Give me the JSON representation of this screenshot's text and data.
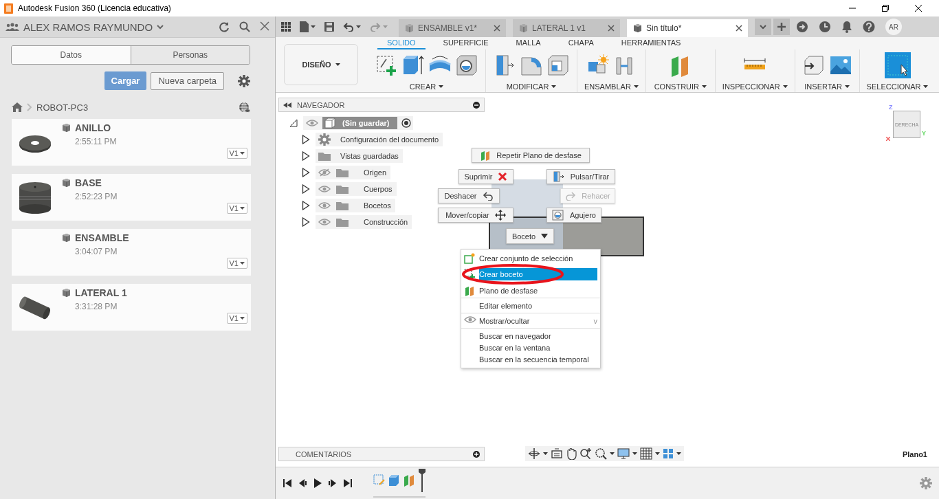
{
  "window": {
    "title": "Autodesk Fusion 360 (Licencia educativa)"
  },
  "data_panel": {
    "user": "ALEX RAMOS RAYMUNDO",
    "tabs": [
      {
        "label": "Datos",
        "selected": true
      },
      {
        "label": "Personas",
        "selected": false
      }
    ],
    "upload_button": "Cargar",
    "new_folder_button": "Nueva carpeta",
    "breadcrumb": "ROBOT-PC3",
    "files": [
      {
        "name": "ANILLO",
        "time": "2:55:11 PM",
        "version": "V1",
        "kind": "ring"
      },
      {
        "name": "BASE",
        "time": "2:52:23 PM",
        "version": "V1",
        "kind": "base"
      },
      {
        "name": "ENSAMBLE",
        "time": "3:04:07 PM",
        "version": "V1",
        "kind": "assembly"
      },
      {
        "name": "LATERAL 1",
        "time": "3:31:28 PM",
        "version": "V1",
        "kind": "cylinder"
      }
    ]
  },
  "document_tabs": [
    {
      "label": "ENSAMBLE v1*",
      "selected": false
    },
    {
      "label": "LATERAL 1 v1",
      "selected": false
    },
    {
      "label": "Sin título*",
      "selected": true
    }
  ],
  "user_initials": "AR",
  "ribbon": {
    "workspace": "DISEÑO",
    "tabs": [
      {
        "label": "SOLIDO",
        "selected": true
      },
      {
        "label": "SUPERFICIE",
        "selected": false
      },
      {
        "label": "MALLA",
        "selected": false
      },
      {
        "label": "CHAPA",
        "selected": false
      },
      {
        "label": "HERRAMIENTAS",
        "selected": false
      }
    ],
    "groups": [
      {
        "label": "CREAR",
        "tools": [
          {
            "kind": "sketch"
          },
          {
            "kind": "extrude"
          },
          {
            "kind": "revolve"
          },
          {
            "kind": "hole"
          }
        ]
      },
      {
        "label": "MODIFICAR",
        "tools": [
          {
            "kind": "pushpull"
          },
          {
            "kind": "fillet"
          },
          {
            "kind": "shell"
          }
        ]
      },
      {
        "label": "ENSAMBLAR",
        "tools": [
          {
            "kind": "component"
          },
          {
            "kind": "joint"
          }
        ]
      },
      {
        "label": "CONSTRUIR",
        "tools": [
          {
            "kind": "plane"
          }
        ]
      },
      {
        "label": "INSPECCIONAR",
        "tools": [
          {
            "kind": "measure"
          }
        ]
      },
      {
        "label": "INSERTAR",
        "tools": [
          {
            "kind": "insert"
          },
          {
            "kind": "image"
          }
        ]
      },
      {
        "label": "SELECCIONAR",
        "tools": [
          {
            "kind": "select"
          }
        ]
      }
    ]
  },
  "navigator": {
    "title": "NAVEGADOR",
    "root": {
      "label": "(Sin guardar)",
      "expanded": true
    },
    "items": [
      {
        "label": "Configuración del documento",
        "kind": "settings"
      },
      {
        "label": "Vistas guardadas",
        "kind": "views"
      },
      {
        "label": "Origen",
        "kind": "folder",
        "visible": false
      },
      {
        "label": "Cuerpos",
        "kind": "folder",
        "visible": true
      },
      {
        "label": "Bocetos",
        "kind": "folder",
        "visible": true
      },
      {
        "label": "Construcción",
        "kind": "folder",
        "visible": true
      }
    ]
  },
  "marking_menu": {
    "buttons": [
      {
        "label": "Repetir Plano de desfase",
        "kind": "plane",
        "disabled": false
      },
      {
        "label": "Suprimir",
        "kind": "delete",
        "disabled": false
      },
      {
        "label": "Pulsar/Tirar",
        "kind": "pushpull",
        "disabled": false
      },
      {
        "label": "Deshacer",
        "kind": "undo",
        "disabled": false
      },
      {
        "label": "Rehacer",
        "kind": "redo",
        "disabled": true
      },
      {
        "label": "Mover/copiar",
        "kind": "move",
        "disabled": false
      },
      {
        "label": "Agujero",
        "kind": "hole",
        "disabled": false
      }
    ],
    "dropdown": "Boceto"
  },
  "context_menu": {
    "sections": [
      {
        "items": [
          {
            "label": "Crear conjunto de selección",
            "kind": "selection-set",
            "selected": false
          },
          {
            "label": "Crear boceto",
            "kind": "sketch",
            "selected": true
          },
          {
            "label": "Plano de desfase",
            "kind": "plane",
            "selected": false
          }
        ]
      },
      {
        "items": [
          {
            "label": "Editar elemento",
            "selected": false
          }
        ]
      },
      {
        "items": [
          {
            "label": "Mostrar/ocultar",
            "kind": "eye",
            "shortcut": "v",
            "selected": false
          }
        ]
      },
      {
        "items": [
          {
            "label": "Buscar en navegador",
            "selected": false
          },
          {
            "label": "Buscar en la ventana",
            "selected": false
          },
          {
            "label": "Buscar en la secuencia temporal",
            "selected": false
          }
        ]
      }
    ]
  },
  "view_cube": {
    "face": "DERECHA",
    "axes": [
      "Z",
      "Y"
    ]
  },
  "comments": {
    "title": "COMENTARIOS"
  },
  "active_plane": "Plano1",
  "timeline": {
    "features": [
      {
        "kind": "sketch"
      },
      {
        "kind": "extrude"
      },
      {
        "kind": "plane"
      }
    ]
  }
}
